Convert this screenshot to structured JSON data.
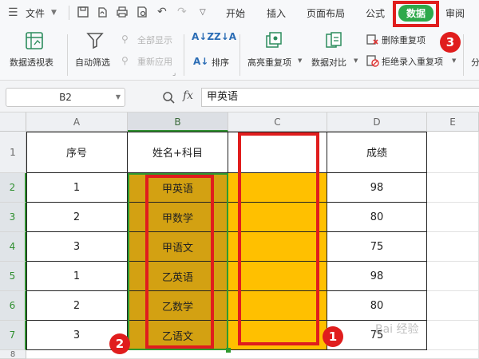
{
  "menubar": {
    "file_label": "文件",
    "tabs": [
      "开始",
      "插入",
      "页面布局",
      "公式",
      "数据",
      "审阅"
    ],
    "active_tab": "数据"
  },
  "ribbon": {
    "pivot": "数据透视表",
    "autofilter": "自动筛选",
    "show_all": "全部显示",
    "reapply": "重新应用",
    "sort": "排序",
    "highlight_dup": "高亮重复项",
    "compare": "数据对比",
    "remove_dup": "删除重复项",
    "reject_dup": "拒绝录入重复项",
    "split_partial": "分"
  },
  "formula_bar": {
    "cell_ref": "B2",
    "fx": "fx",
    "value": "甲英语"
  },
  "columns": [
    "A",
    "B",
    "C",
    "D",
    "E"
  ],
  "rows": [
    "1",
    "2",
    "3",
    "4",
    "5",
    "6",
    "7",
    "8"
  ],
  "table": {
    "headers": [
      "序号",
      "姓名+科目",
      "",
      "成绩"
    ],
    "rows": [
      [
        "1",
        "甲英语",
        "",
        "98"
      ],
      [
        "2",
        "甲数学",
        "",
        "80"
      ],
      [
        "3",
        "甲语文",
        "",
        "75"
      ],
      [
        "1",
        "乙英语",
        "",
        "98"
      ],
      [
        "2",
        "乙数学",
        "",
        "80"
      ],
      [
        "3",
        "乙语文",
        "",
        "75"
      ]
    ]
  },
  "annotations": {
    "badge1": "1",
    "badge2": "2",
    "badge3": "3",
    "watermark": "Bai 经验"
  },
  "colors": {
    "accent_green": "#2ea94b",
    "highlight_yellow": "#ffc000",
    "highlight_orange": "#d3a112",
    "annotation_red": "#e01d1d"
  }
}
